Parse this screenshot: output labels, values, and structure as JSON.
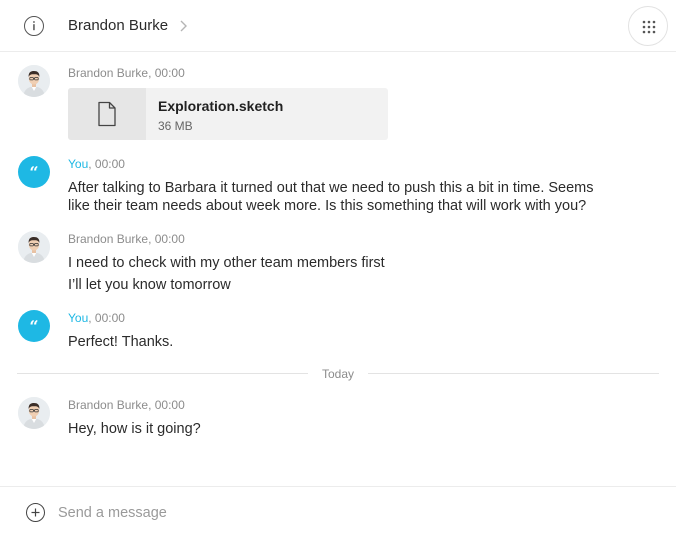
{
  "header": {
    "contact_name": "Brandon Burke",
    "info_icon": "info-icon",
    "chevron_icon": "chevron-right-icon",
    "apps_icon": "grid-dots-icon"
  },
  "messages": [
    {
      "sender": "Brandon Burke",
      "time": ", 00:00",
      "attachment": {
        "name": "Exploration.sketch",
        "size": "36 MB",
        "icon": "file-icon"
      }
    },
    {
      "sender": "You",
      "time": ", 00:00",
      "lines": [
        "After talking to Barbara it turned out that we need to push this a bit in time. Seems",
        "like their team needs about week more. Is this something that will work with you?"
      ]
    },
    {
      "sender": "Brandon Burke",
      "time": ", 00:00",
      "lines": [
        "I need to check with my other team members first",
        "I’ll let you know tomorrow"
      ]
    },
    {
      "sender": "You",
      "time": ", 00:00",
      "lines": [
        "Perfect! Thanks."
      ]
    },
    {
      "sender": "Brandon Burke",
      "time": ", 00:00",
      "lines": [
        "Hey, how is it going?"
      ]
    }
  ],
  "divider": {
    "label": "Today"
  },
  "composer": {
    "placeholder": "Send a message",
    "value": "",
    "add_icon": "plus-circle-icon"
  },
  "colors": {
    "accent": "#1eb8e4",
    "meta_text": "#8c8c8c",
    "file_card": "#f2f2f2"
  }
}
